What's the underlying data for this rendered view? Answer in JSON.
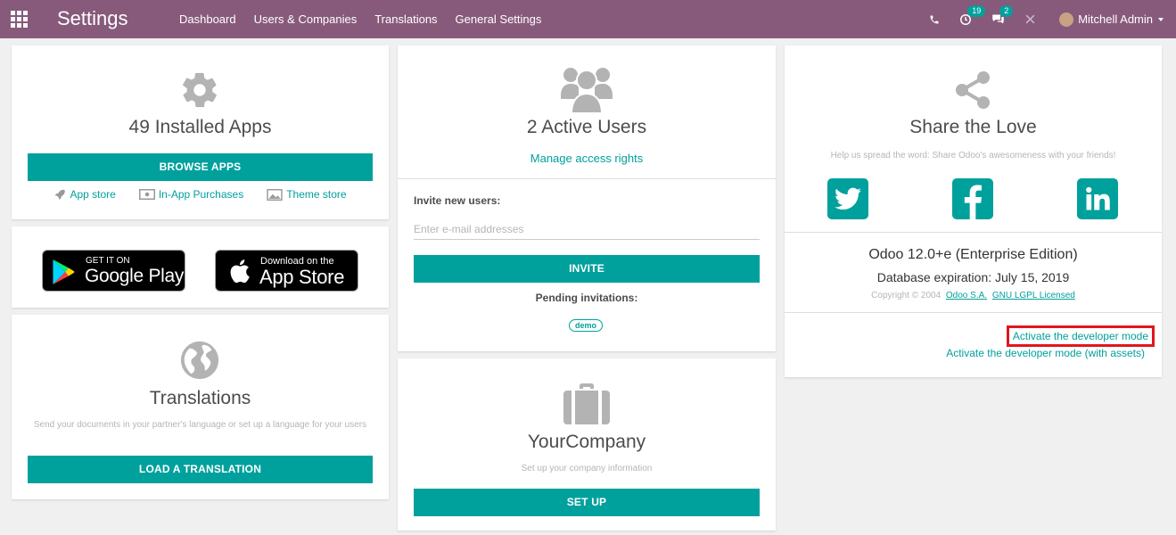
{
  "navbar": {
    "brand": "Settings",
    "menu": [
      "Dashboard",
      "Users & Companies",
      "Translations",
      "General Settings"
    ],
    "activities_count": "19",
    "messages_count": "2",
    "user_name": "Mitchell Admin",
    "color": "#875a7b"
  },
  "apps": {
    "title": "49 Installed Apps",
    "button": "BROWSE APPS",
    "links": [
      "App store",
      "In-App Purchases",
      "Theme store"
    ],
    "icon": "gear-icon"
  },
  "mobile": {
    "google_small": "GET IT ON",
    "google_big": "Google Play",
    "apple_small": "Download on the",
    "apple_big": "App Store"
  },
  "translations": {
    "title": "Translations",
    "desc": "Send your documents in your partner's language or set up a language for your users",
    "button": "LOAD A TRANSLATION",
    "icon": "globe-icon"
  },
  "users": {
    "title": "2 Active Users",
    "manage_link": "Manage access rights",
    "invite_label": "Invite new users:",
    "invite_placeholder": "Enter e-mail addresses",
    "invite_button": "INVITE",
    "pending_label": "Pending invitations:",
    "pending_tag": "demo",
    "icon": "users-icon"
  },
  "company": {
    "title": "YourCompany",
    "desc": "Set up your company information",
    "button": "SET UP",
    "icon": "briefcase-icon"
  },
  "share": {
    "title": "Share the Love",
    "desc": "Help us spread the word: Share Odoo's awesomeness with your friends!",
    "icon": "share-icon"
  },
  "about": {
    "version": "Odoo 12.0+e (Enterprise Edition)",
    "expiration": "Database expiration: July 15, 2019",
    "copyright": "Copyright © 2004",
    "odoo_link": "Odoo S.A.",
    "license_link": "GNU LGPL Licensed",
    "dev_mode": "Activate the developer mode",
    "dev_mode_assets": "Activate the developer mode (with assets)"
  },
  "accent": "#00a09d",
  "highlight": "#e0161e"
}
